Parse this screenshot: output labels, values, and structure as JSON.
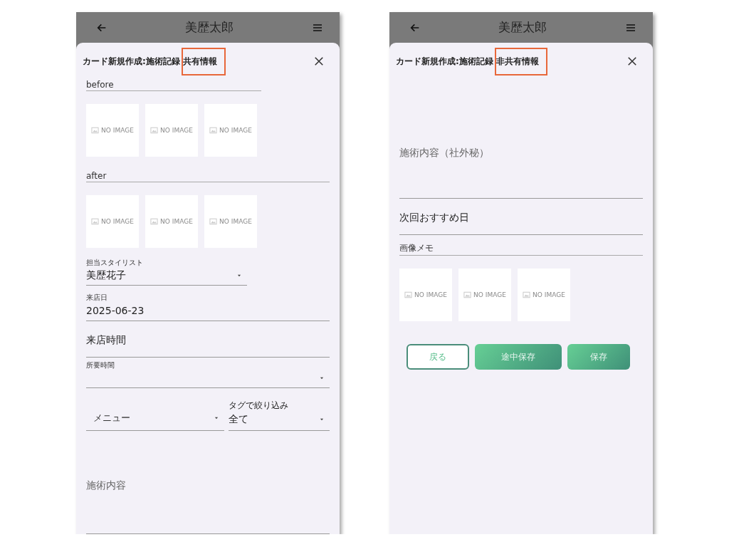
{
  "phones": [
    {
      "header": {
        "title": "美歴太郎"
      },
      "dialog": {
        "title": "カード新規作成:施術記録",
        "highlighted": "共有情報"
      },
      "fields": [
        {
          "kind": "line-label",
          "text": "before",
          "short": true
        },
        {
          "kind": "images",
          "tiles": [
            "NO IMAGE",
            "NO IMAGE",
            "NO IMAGE"
          ]
        },
        {
          "kind": "line-label",
          "text": "after",
          "short": false
        },
        {
          "kind": "images",
          "tiles": [
            "NO IMAGE",
            "NO IMAGE",
            "NO IMAGE"
          ]
        },
        {
          "kind": "dropdown",
          "label": "担当スタイリスト",
          "value": "美歴花子",
          "short": true
        },
        {
          "kind": "text",
          "label": "来店日",
          "value": "2025-06-23"
        },
        {
          "kind": "hint",
          "text": "来店時間"
        },
        {
          "kind": "dropdown",
          "label": "所要時間",
          "short": false
        },
        {
          "kind": "row",
          "items": [
            {
              "kind": "dropdown",
              "placeholder": "メニュー"
            },
            {
              "kind": "dropdown",
              "label": "タグで絞り込み",
              "value": "全て"
            }
          ]
        },
        {
          "kind": "textarea",
          "placeholder": "施術内容"
        }
      ]
    },
    {
      "header": {
        "title": "美歴太郎"
      },
      "dialog": {
        "title": "カード新規作成:施術記録",
        "highlighted": "非共有情報"
      },
      "fields": [
        {
          "kind": "textarea",
          "placeholder": "施術内容（社外秘）"
        },
        {
          "kind": "hint",
          "text": "次回おすすめ日"
        },
        {
          "kind": "line-label",
          "text": "画像メモ",
          "short": false
        },
        {
          "kind": "images",
          "tiles": [
            "NO IMAGE",
            "NO IMAGE",
            "NO IMAGE"
          ]
        },
        {
          "kind": "buttons",
          "items": [
            {
              "kind": "outline",
              "label": "戻る"
            },
            {
              "kind": "filled",
              "label": "途中保存"
            },
            {
              "kind": "filled",
              "label": "保存"
            }
          ]
        }
      ]
    }
  ]
}
